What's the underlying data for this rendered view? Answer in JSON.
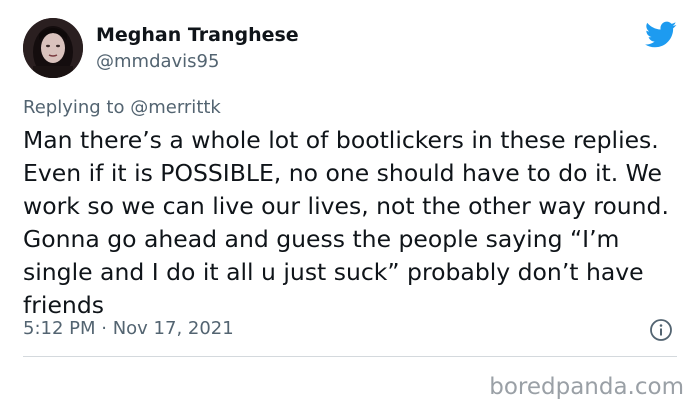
{
  "author": {
    "display_name": "Meghan Tranghese",
    "handle": "@mmdavis95",
    "avatar": "profile-photo"
  },
  "brand": {
    "icon": "twitter-bird-icon",
    "color": "#1d9bf0"
  },
  "reply": {
    "prefix": "Replying to",
    "mention": "@merrittk"
  },
  "tweet": {
    "text": "Man there’s a whole lot of bootlickers in these replies. Even if it is POSSIBLE, no one should have to do it. We work so we can live our lives, not the other way round. Gonna go ahead and guess the people saying “I’m single and I do it all u just suck” probably don’t have friends",
    "timestamp": "5:12 PM · Nov 17, 2021",
    "info_icon": "info-icon"
  },
  "watermark": {
    "text": "boredpanda.com"
  },
  "colors": {
    "text_primary": "#0f1419",
    "text_secondary": "#536471",
    "divider": "#d4d9dd",
    "watermark": "#9aa0a6"
  }
}
